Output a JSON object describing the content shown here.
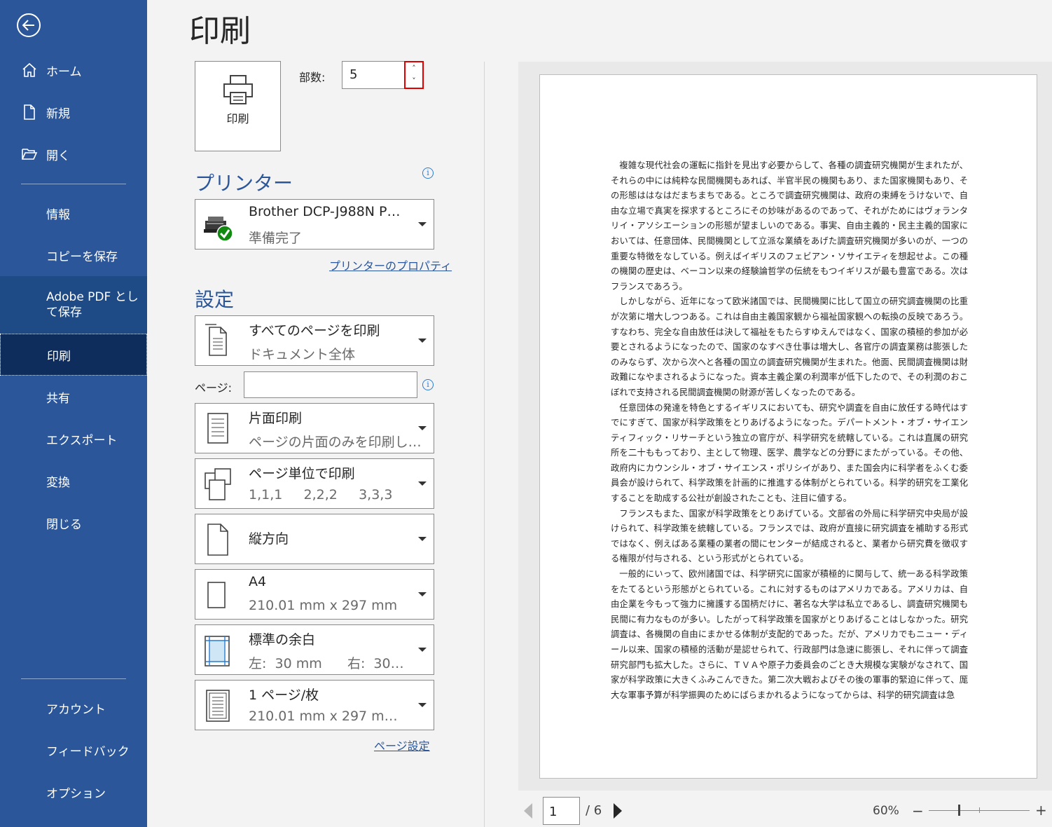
{
  "sidebar": {
    "items": [
      {
        "label": "ホーム",
        "icon": "home-icon"
      },
      {
        "label": "新規",
        "icon": "new-document-icon"
      },
      {
        "label": "開く",
        "icon": "open-folder-icon"
      },
      {
        "label": "情報"
      },
      {
        "label": "コピーを保存"
      },
      {
        "label": "Adobe PDF として保存"
      },
      {
        "label": "印刷"
      },
      {
        "label": "共有"
      },
      {
        "label": "エクスポート"
      },
      {
        "label": "変換"
      },
      {
        "label": "閉じる"
      },
      {
        "label": "アカウント"
      },
      {
        "label": "フィードバック"
      },
      {
        "label": "オプション"
      }
    ]
  },
  "main": {
    "title": "印刷",
    "print_button_label": "印刷",
    "copies_label": "部数:",
    "copies_value": "5",
    "printer_heading": "プリンター",
    "printer_name": "Brother DCP-J988N P…",
    "printer_status": "準備完了",
    "printer_properties_link": "プリンターのプロパティ",
    "settings_heading": "設定",
    "pages_label": "ページ:",
    "pages_value": "",
    "page_setup_link": "ページ設定"
  },
  "settings": [
    {
      "main": "すべてのページを印刷",
      "sub": "ドキュメント全体",
      "icon": "pages-icon"
    },
    {
      "main": "片面印刷",
      "sub": "ページの片面のみを印刷し…",
      "icon": "one-sided-icon"
    },
    {
      "main": "ページ単位で印刷",
      "sub": "1,1,1     2,2,2     3,3,3",
      "icon": "uncollated-icon"
    },
    {
      "main": "縦方向",
      "sub": "",
      "icon": "portrait-icon"
    },
    {
      "main": "A4",
      "sub": "210.01 mm x 297 mm",
      "icon": "paper-size-icon"
    },
    {
      "main": "標準の余白",
      "sub": "左:  30 mm      右:  30…",
      "icon": "margins-icon"
    },
    {
      "main": "1 ページ/枚",
      "sub": "210.01 mm x 297 m…",
      "icon": "pages-per-sheet-icon"
    }
  ],
  "preview": {
    "paragraphs": [
      "複雑な現代社会の運転に指針を見出す必要からして、各種の調査研究機関が生まれたが、それらの中には純粋な民間機関もあれば、半官半民の機関もあり、また国家機関もあり、その形態ははなはだまちまちである。ところで調査研究機関は、政府の束縛をうけないで、自由な立場で真実を探求するところにその妙味があるのであって、それがためにはヴォランタリイ・アソシエーションの形態が望ましいのである。事実、自由主義的・民主主義的国家においては、任意団体、民間機関として立派な業績をあげた調査研究機関が多いのが、一つの重要な特徴をなしている。例えばイギリスのフェビアン・ソサイエティを想起せよ。この種の機関の歴史は、ベーコン以来の経験論哲学の伝統をもつイギリスが最も豊富である。次はフランスであろう。",
      "しかしながら、近年になって欧米諸国では、民間機関に比して国立の研究調査機関の比重が次第に増大しつつある。これは自由主義国家観から福祉国家観への転換の反映であろう。すなわち、完全な自由放任は決して福祉をもたらすゆえんではなく、国家の積極的参加が必要とされるようになったので、国家のなすべき仕事は増大し、各官庁の調査業務は膨張したのみならず、次から次へと各種の国立の調査研究機関が生まれた。他面、民間調査機関は財政難になやまされるようになった。資本主義企業の利潤率が低下したので、その利潤のおこぼれで支持される民間調査機関の財源が苦しくなったのである。",
      "任意団体の発達を特色とするイギリスにおいても、研究や調査を自由に放任する時代はすでにすぎて、国家が科学政策をとりあげるようになった。デパートメント・オブ・サイエンティフィック・リサーチという独立の官庁が、科学研究を統轄している。これは直属の研究所を二十ももっており、主として物理、医学、農学などの分野にまたがっている。その他、政府内にカウンシル・オブ・サイエンス・ポリシイがあり、また国会内に科学者をふくむ委員会が設けられて、科学政策を計画的に推進する体制がとられている。科学的研究を工業化することを助成する公社が創設されたことも、注目に値する。",
      "フランスもまた、国家が科学政策をとりあげている。文部省の外局に科学研究中央局が設けられて、科学政策を統轄している。フランスでは、政府が直接に研究調査を補助する形式ではなく、例えばある業種の業者の間にセンターが結成されると、業者から研究費を徴収する権限が付与される、という形式がとられている。",
      "一般的にいって、欧州諸国では、科学研究に国家が積極的に関与して、統一ある科学政策をたてるという形態がとられている。これに対するものはアメリカである。アメリカは、自由企業を今もって強力に擁護する国柄だけに、著名な大学は私立であるし、調査研究機関も民間に有力なものが多い。したがって科学政策を国家がとりあげることはしなかった。研究調査は、各機関の自由にまかせる体制が支配的であった。だが、アメリカでもニュー・ディール以来、国家の積極的活動が是認せられて、行政部門は急速に膨張し、それに伴って調査研究部門も拡大した。さらに、ＴＶＡや原子力委員会のごとき大規模な実験がなされて、国家が科学政策に大きくふみこんできた。第二次大戦およびその後の軍事的緊迫に伴って、厖大な軍事予算が科学振興のためにばらまかれるようになってからは、科学的研究調査は急"
    ]
  },
  "nav": {
    "current_page": "1",
    "total_pages": "/ 6",
    "zoom": "60%",
    "zoom_minus": "−",
    "zoom_plus": "+"
  }
}
